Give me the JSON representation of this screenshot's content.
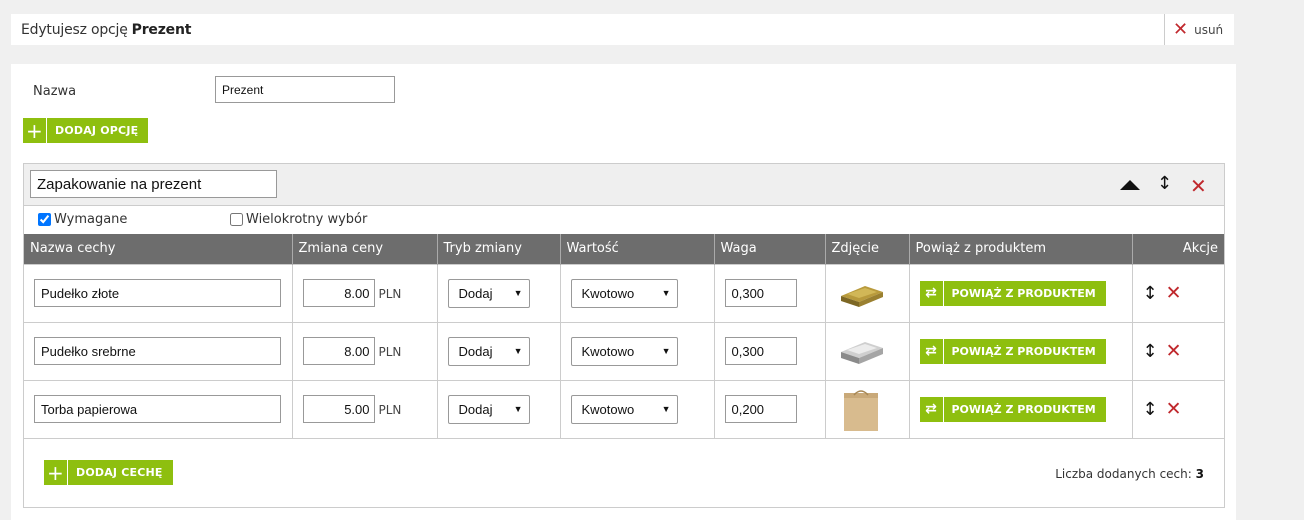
{
  "header": {
    "prefix": "Edytujesz opcję",
    "option_name": "Prezent",
    "delete_label": "usuń"
  },
  "form": {
    "name_label": "Nazwa",
    "name_value": "Prezent",
    "add_option_label": "DODAJ OPCJĘ"
  },
  "group": {
    "title_value": "Zapakowanie na prezent",
    "required_label": "Wymagane",
    "required_checked": true,
    "multiple_label": "Wielokrotny wybór",
    "multiple_checked": false
  },
  "table": {
    "headers": [
      "Nazwa cechy",
      "Zmiana ceny",
      "Tryb zmiany",
      "Wartość",
      "Waga",
      "Zdjęcie",
      "Powiąż z produktem",
      "Akcje"
    ],
    "currency": "PLN",
    "link_label": "POWIĄŻ Z PRODUKTEM",
    "rows": [
      {
        "name": "Pudełko złote",
        "price": "8.00",
        "mode": "Dodaj",
        "value": "Kwotowo",
        "weight": "0,300",
        "image": "gold-box-image"
      },
      {
        "name": "Pudełko srebrne",
        "price": "8.00",
        "mode": "Dodaj",
        "value": "Kwotowo",
        "weight": "0,300",
        "image": "silver-box-image"
      },
      {
        "name": "Torba papierowa",
        "price": "5.00",
        "mode": "Dodaj",
        "value": "Kwotowo",
        "weight": "0,200",
        "image": "paper-bag-image"
      }
    ]
  },
  "footer": {
    "add_feature_label": "DODAJ CECHĘ",
    "count_label": "Liczba dodanych cech:",
    "count_value": "3"
  },
  "colors": {
    "accent_green": "#8ebf0f",
    "delete_red": "#c0282d",
    "header_gray": "#6d6d6d"
  }
}
